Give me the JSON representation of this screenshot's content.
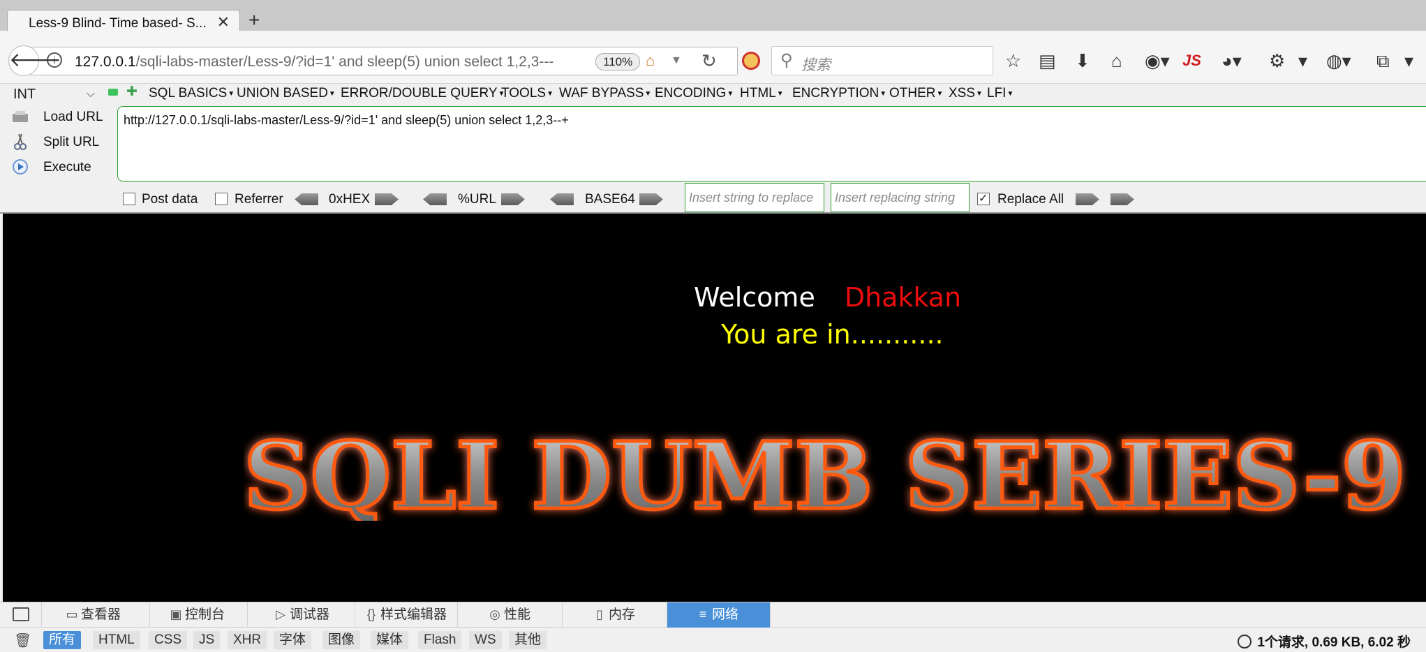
{
  "tab": {
    "title": "Less-9 Blind- Time based- S...",
    "close": "✕",
    "new_tab": "+"
  },
  "nav": {
    "url_host": "127.0.0.1",
    "url_path": "/sqli-labs-master/Less-9/?id=1'  and sleep(5) union select 1,2,3---",
    "zoom": "110%",
    "search_placeholder": "搜索",
    "js_icon": "JS"
  },
  "hackbar": {
    "select_value": "INT",
    "menus": [
      "SQL BASICS",
      "UNION BASED",
      "ERROR/DOUBLE QUERY",
      "TOOLS",
      "WAF BYPASS",
      "ENCODING",
      "HTML",
      "ENCRYPTION",
      "OTHER",
      "XSS",
      "LFI"
    ],
    "load_url": "Load URL",
    "split_url": "Split URL",
    "execute": "Execute",
    "url_text": "http://127.0.0.1/sqli-labs-master/Less-9/?id=1'  and sleep(5) union select 1,2,3--+",
    "post_data": "Post data",
    "referrer": "Referrer",
    "hex": "0xHEX",
    "urlenc": "%URL",
    "base64": "BASE64",
    "insert_find_placeholder": "Insert string to replace",
    "insert_replace_placeholder": "Insert replacing string",
    "replace_all": "Replace All"
  },
  "content": {
    "welcome": "Welcome",
    "name": "Dhakkan",
    "you_are_in": "You are in...........",
    "banner": "SQLI DUMB SERIES-9"
  },
  "devtools": {
    "tabs": [
      "查看器",
      "控制台",
      "调试器",
      "样式编辑器",
      "性能",
      "内存",
      "网络"
    ],
    "filters": [
      "所有",
      "HTML",
      "CSS",
      "JS",
      "XHR",
      "字体",
      "图像",
      "媒体",
      "Flash",
      "WS",
      "其他"
    ],
    "summary": "1个请求, 0.69 KB, 6.02 秒"
  }
}
